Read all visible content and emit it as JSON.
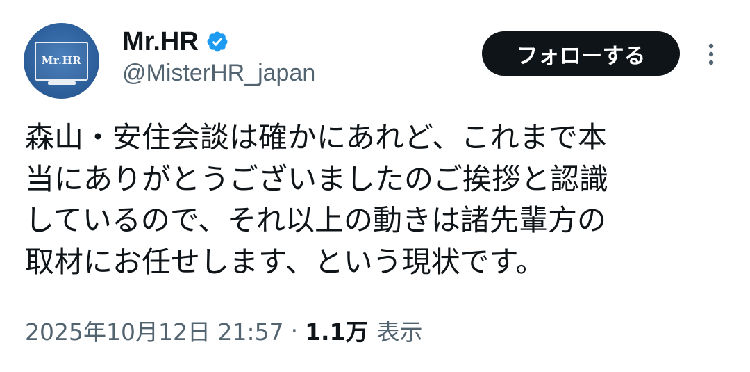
{
  "author": {
    "avatar_text": "Mr.HR",
    "display_name": "Mr.HR",
    "handle": "@MisterHR_japan",
    "verified": true
  },
  "follow_button": {
    "label": "フォローする"
  },
  "tweet": {
    "lines": [
      "森山・安住会談は確かにあれど、これまで本",
      "当にありがとうございましたのご挨拶と認識",
      "しているので、それ以上の動きは諸先輩方の",
      "取材にお任せします、という現状です。"
    ]
  },
  "meta": {
    "timestamp": "2025年10月12日 21:57",
    "separator": "·",
    "views_count": "1.1万",
    "views_label": "表示"
  },
  "colors": {
    "text_primary": "#0f1419",
    "text_secondary": "#536471",
    "verified_blue": "#1d9bf0",
    "avatar_blue": "#2b5c97",
    "follow_button_bg": "#0f1419",
    "divider": "#eff3f4"
  },
  "icons": {
    "verified": "verified-badge-icon",
    "more": "more-vertical-icon"
  }
}
